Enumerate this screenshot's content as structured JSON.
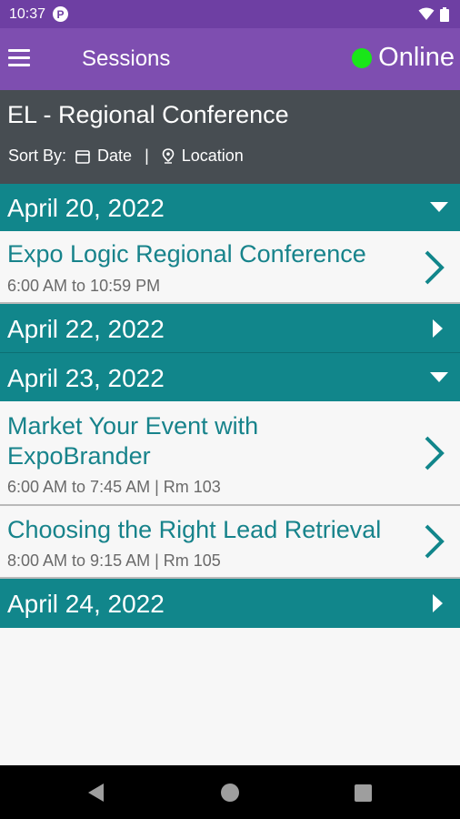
{
  "status_bar": {
    "time": "10:37",
    "app_icon_letter": "P"
  },
  "app_bar": {
    "title": "Sessions",
    "status": "Online",
    "status_color": "#19e619"
  },
  "conference": {
    "title": "EL - Regional Conference",
    "sort_by_label": "Sort By:",
    "sort_options": [
      "Date",
      "Location"
    ],
    "separator": "|"
  },
  "days": [
    {
      "date": "April 20, 2022",
      "expanded": true,
      "sessions": [
        {
          "title": "Expo Logic Regional Conference",
          "time": "6:00 AM to 10:59 PM"
        }
      ]
    },
    {
      "date": "April 22, 2022",
      "expanded": false,
      "sessions": []
    },
    {
      "date": "April 23, 2022",
      "expanded": true,
      "sessions": [
        {
          "title": "Market Your Event with ExpoBrander",
          "time": "6:00 AM to 7:45 AM | Rm 103"
        },
        {
          "title": "Choosing the Right Lead Retrieval",
          "time": "8:00 AM to 9:15 AM | Rm 105"
        }
      ]
    },
    {
      "date": "April 24, 2022",
      "expanded": false,
      "sessions": []
    }
  ],
  "colors": {
    "status_bar": "#6e3fa3",
    "app_bar": "#7e4eb0",
    "header": "#474d52",
    "teal": "#11868b",
    "session_title": "#17838b"
  }
}
